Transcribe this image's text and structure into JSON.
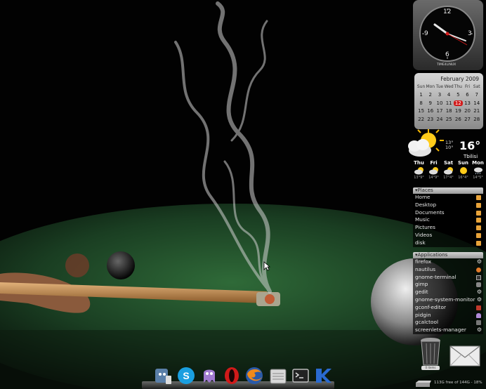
{
  "clock": {
    "brand": "TIME4LINUX",
    "numerals": [
      "12",
      "3",
      "6",
      "9"
    ]
  },
  "calendar": {
    "month_year": "February 2009",
    "day_headers": [
      "Sun",
      "Mon",
      "Tue",
      "Wed",
      "Thu",
      "Fri",
      "Sat"
    ],
    "weeks": [
      [
        "1",
        "2",
        "3",
        "4",
        "5",
        "6",
        "7"
      ],
      [
        "8",
        "9",
        "10",
        "11",
        "12",
        "13",
        "14"
      ],
      [
        "15",
        "16",
        "17",
        "18",
        "19",
        "20",
        "21"
      ],
      [
        "22",
        "23",
        "24",
        "25",
        "26",
        "27",
        "28"
      ]
    ],
    "today": "12",
    "today_color": "#d21a1a"
  },
  "weather": {
    "current_temp": "16°",
    "temp_high": "13°",
    "temp_low": "10°",
    "city": "Tbilisi",
    "forecast": [
      {
        "day": "Thu",
        "temps": "13°9°",
        "icon": "cloud-sun-icon"
      },
      {
        "day": "Fri",
        "temps": "14°9°",
        "icon": "cloud-sun-icon"
      },
      {
        "day": "Sat",
        "temps": "17°4°",
        "icon": "cloud-sun-icon"
      },
      {
        "day": "Sun",
        "temps": "16°4°",
        "icon": "sun-icon"
      },
      {
        "day": "Mon",
        "temps": "14°5°",
        "icon": "cloud-rain-icon"
      }
    ]
  },
  "places": {
    "title": "▾Places",
    "items": [
      "Home",
      "Desktop",
      "Documents",
      "Music",
      "Pictures",
      "Videos",
      "disk"
    ]
  },
  "applications": {
    "title": "▾Applications",
    "items": [
      "firefox",
      "nautilus",
      "gnome-terminal",
      "gimp",
      "gedit",
      "gnome-system-monitor",
      "gconf-editor",
      "pidgin",
      "gcalctool",
      "screenlets-manager"
    ]
  },
  "trash": {
    "label": "0 items"
  },
  "disk": {
    "text": "113G free of 144G - 18%"
  },
  "dock": {
    "items": [
      "finder-face-icon",
      "skype-icon",
      "pidgin-icon",
      "opera-icon",
      "firefox-icon",
      "files-icon",
      "terminal-icon",
      "kftp-icon"
    ]
  },
  "colors": {
    "felt": "#1e4a26",
    "panel_bg": "#000000",
    "accent_red": "#d21a1a"
  }
}
